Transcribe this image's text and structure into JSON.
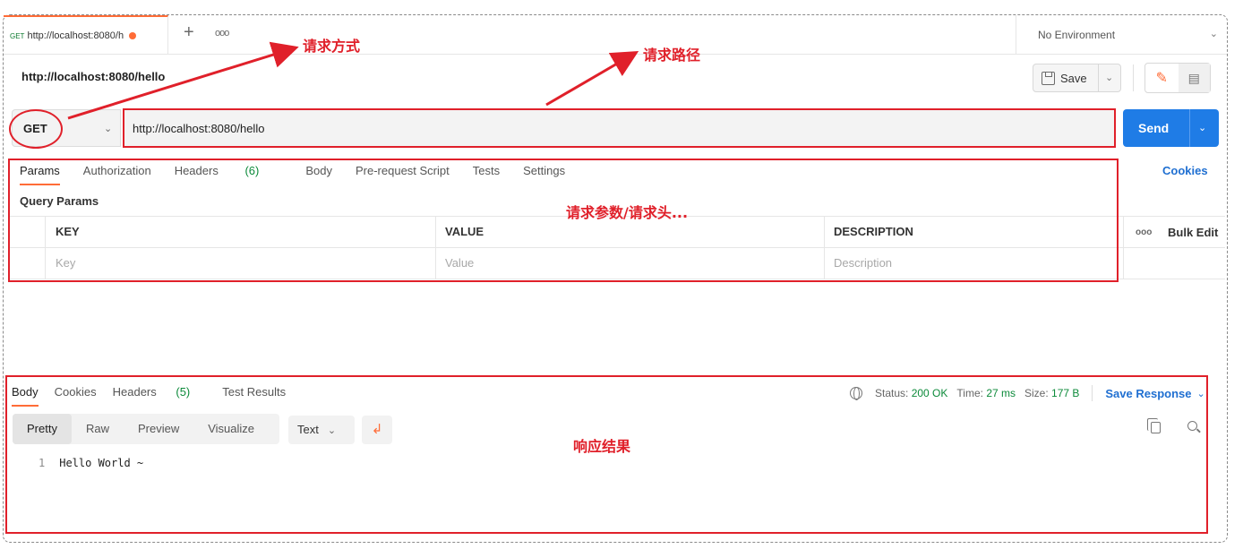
{
  "tab": {
    "method": "GET",
    "name": "http://localhost:8080/h"
  },
  "environment": {
    "label": "No Environment"
  },
  "request": {
    "title": "http://localhost:8080/hello",
    "method": "GET",
    "url": "http://localhost:8080/hello",
    "save_label": "Save",
    "send_label": "Send"
  },
  "request_tabs": [
    {
      "label": "Params"
    },
    {
      "label": "Authorization"
    },
    {
      "label": "Headers",
      "count": "(6)"
    },
    {
      "label": "Body"
    },
    {
      "label": "Pre-request Script"
    },
    {
      "label": "Tests"
    },
    {
      "label": "Settings"
    }
  ],
  "cookies_label": "Cookies",
  "query_params": {
    "title": "Query Params",
    "headers": [
      "KEY",
      "VALUE",
      "DESCRIPTION"
    ],
    "placeholders": [
      "Key",
      "Value",
      "Description"
    ],
    "bulk_edit_label": "Bulk Edit",
    "more_label": "ooo"
  },
  "response": {
    "tabs": [
      {
        "label": "Body"
      },
      {
        "label": "Cookies"
      },
      {
        "label": "Headers",
        "count": "(5)"
      },
      {
        "label": "Test Results"
      }
    ],
    "status_label": "Status:",
    "status_value": "200 OK",
    "time_label": "Time:",
    "time_value": "27 ms",
    "size_label": "Size:",
    "size_value": "177 B",
    "save_response_label": "Save Response",
    "formats": [
      "Pretty",
      "Raw",
      "Preview",
      "Visualize"
    ],
    "text_type": "Text",
    "code_lines": [
      {
        "num": "1",
        "text": "Hello World ~"
      }
    ]
  },
  "annotations": {
    "method_label": "请求方式",
    "path_label": "请求路径",
    "params_label": "请求参数/请求头...",
    "result_label": "响应结果"
  },
  "colors": {
    "accent": "#ff6c37",
    "send": "#1f7ce6",
    "annotation": "#e0202a",
    "success": "#0c8a3a"
  }
}
